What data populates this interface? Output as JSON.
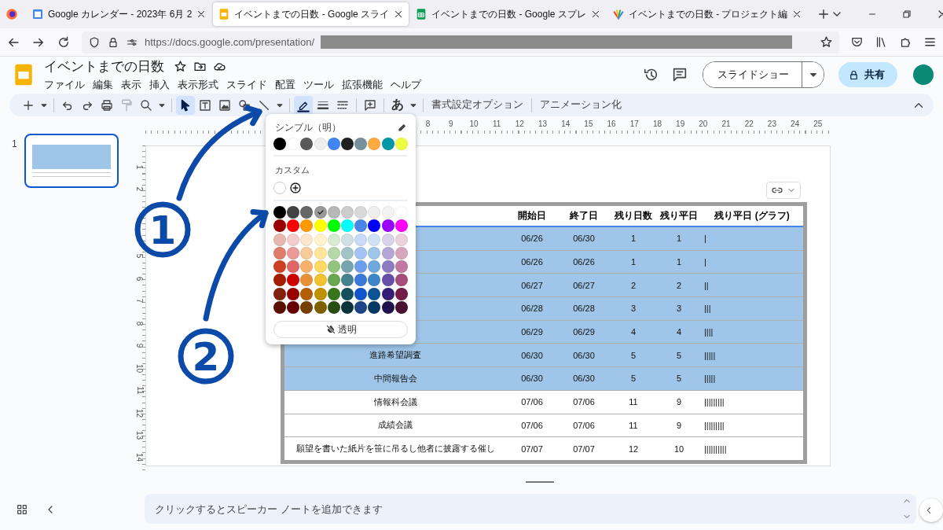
{
  "browser": {
    "tabs": [
      {
        "title": "Google カレンダー - 2023年 6月 2",
        "kind": "calendar",
        "selected": false
      },
      {
        "title": "イベントまでの日数 - Google スライ",
        "kind": "slides",
        "selected": true
      },
      {
        "title": "イベントまでの日数 - Google スプレ",
        "kind": "sheets",
        "selected": false
      },
      {
        "title": "イベントまでの日数 - プロジェクト編",
        "kind": "project",
        "selected": false
      }
    ],
    "url": "https://docs.google.com/presentation/"
  },
  "app": {
    "title": "イベントまでの日数",
    "menu": [
      "ファイル",
      "編集",
      "表示",
      "挿入",
      "表示形式",
      "スライド",
      "配置",
      "ツール",
      "拡張機能",
      "ヘルプ"
    ],
    "slideshow_label": "スライドショー",
    "share_label": "共有"
  },
  "toolbar": {
    "tools": [
      {
        "kind": "add",
        "active": false,
        "disabled": false
      },
      {
        "kind": "caret",
        "active": false,
        "disabled": false
      },
      {
        "kind": "divider"
      },
      {
        "kind": "undo",
        "active": false,
        "disabled": false
      },
      {
        "kind": "redo",
        "active": false,
        "disabled": false
      },
      {
        "kind": "print",
        "active": false,
        "disabled": false
      },
      {
        "kind": "paint-format",
        "active": false,
        "disabled": true
      },
      {
        "kind": "zoom",
        "active": false,
        "disabled": false
      },
      {
        "kind": "caret",
        "active": false,
        "disabled": false
      },
      {
        "kind": "divider"
      },
      {
        "kind": "select",
        "active": true,
        "disabled": false
      },
      {
        "kind": "textbox",
        "active": false,
        "disabled": false
      },
      {
        "kind": "image",
        "active": false,
        "disabled": false
      },
      {
        "kind": "shape",
        "active": false,
        "disabled": false
      },
      {
        "kind": "line",
        "active": false,
        "disabled": false
      },
      {
        "kind": "caret",
        "active": false,
        "disabled": false
      },
      {
        "kind": "divider"
      },
      {
        "kind": "pen",
        "active": true,
        "disabled": false
      },
      {
        "kind": "line-weight",
        "active": false,
        "disabled": false
      },
      {
        "kind": "line-dash",
        "active": false,
        "disabled": false
      },
      {
        "kind": "divider"
      },
      {
        "kind": "comment",
        "active": false,
        "disabled": false
      },
      {
        "kind": "divider"
      },
      {
        "kind": "glyph",
        "label": "あ",
        "active": false,
        "disabled": false
      },
      {
        "kind": "caret",
        "active": false,
        "disabled": false
      },
      {
        "kind": "divider"
      },
      {
        "kind": "text-button",
        "label": "書式設定オプション",
        "active": false,
        "disabled": false
      },
      {
        "kind": "divider"
      },
      {
        "kind": "text-button",
        "label": "アニメーション化",
        "active": false,
        "disabled": false
      }
    ]
  },
  "filmstrip": {
    "slides": [
      {
        "number": "1",
        "selected": true
      }
    ]
  },
  "ruler": {
    "horizontal": [
      "8",
      "9",
      "10",
      "11",
      "12",
      "13",
      "14",
      "15",
      "16",
      "17",
      "18",
      "19",
      "20",
      "21",
      "22",
      "23",
      "24",
      "25"
    ],
    "vertical_upper": [
      "1",
      "2"
    ],
    "vertical_lower": [
      "5",
      "6",
      "7",
      "8",
      "9",
      "10",
      "11",
      "12",
      "13",
      "14"
    ]
  },
  "table": {
    "columns": [
      "開始日",
      "終了日",
      "残り日数",
      "残り平日",
      "残り平日 (グラフ)"
    ],
    "rows": [
      {
        "selected": true,
        "cells": [
          "06/26",
          "06/30",
          "1",
          "1",
          "|"
        ]
      },
      {
        "selected": true,
        "cells": [
          "06/26",
          "06/26",
          "1",
          "1",
          "|"
        ]
      },
      {
        "selected": true,
        "cells": [
          "06/27",
          "06/27",
          "2",
          "2",
          "||"
        ]
      },
      {
        "selected": true,
        "cells": [
          "06/28",
          "06/28",
          "3",
          "3",
          "|||"
        ]
      },
      {
        "selected": true,
        "cells": [
          "06/29",
          "06/29",
          "4",
          "4",
          "||||"
        ]
      },
      {
        "selected": true,
        "name": "進路希望調査",
        "cells": [
          "06/30",
          "06/30",
          "5",
          "5",
          "|||||"
        ]
      },
      {
        "selected": true,
        "name": "中間報告会",
        "cells": [
          "06/30",
          "06/30",
          "5",
          "5",
          "|||||"
        ]
      },
      {
        "selected": false,
        "name": "情報科会議",
        "cells": [
          "07/06",
          "07/06",
          "11",
          "9",
          "|||||||||"
        ]
      },
      {
        "selected": false,
        "name": "成績会議",
        "cells": [
          "07/06",
          "07/06",
          "11",
          "9",
          "|||||||||"
        ]
      },
      {
        "selected": false,
        "name": "願望を書いた紙片を笹に吊るし他者に披露する催し",
        "cells": [
          "07/07",
          "07/07",
          "12",
          "10",
          "||||||||||"
        ]
      }
    ]
  },
  "color_menu": {
    "theme_name": "シンプル（明）",
    "theme_colors": [
      {
        "color": "#000000",
        "selected": false
      },
      {
        "color": "#ffffff",
        "selected": false
      },
      {
        "color": "#595959",
        "selected": false
      },
      {
        "color": "#eeeeee",
        "selected": false
      },
      {
        "color": "#4285f4",
        "selected": false
      },
      {
        "color": "#212121",
        "selected": false
      },
      {
        "color": "#78909c",
        "selected": false
      },
      {
        "color": "#ffab40",
        "selected": false
      },
      {
        "color": "#0097a7",
        "selected": false
      },
      {
        "color": "#eeff41",
        "selected": false
      }
    ],
    "custom_label": "カスタム",
    "palette": [
      [
        {
          "color": "#000000",
          "selected": false
        },
        {
          "color": "#434343",
          "selected": false
        },
        {
          "color": "#666666",
          "selected": false
        },
        {
          "color": "#999999",
          "selected": true
        },
        {
          "color": "#b7b7b7",
          "selected": false
        },
        {
          "color": "#cccccc",
          "selected": false
        },
        {
          "color": "#d9d9d9",
          "selected": false
        },
        {
          "color": "#efefef",
          "selected": false
        },
        {
          "color": "#f3f3f3",
          "selected": false
        },
        {
          "color": "#ffffff",
          "selected": false
        }
      ],
      [
        {
          "color": "#980000",
          "selected": false
        },
        {
          "color": "#ff0000",
          "selected": false
        },
        {
          "color": "#ff9900",
          "selected": false
        },
        {
          "color": "#ffff00",
          "selected": false
        },
        {
          "color": "#00ff00",
          "selected": false
        },
        {
          "color": "#00ffff",
          "selected": false
        },
        {
          "color": "#4a86e8",
          "selected": false
        },
        {
          "color": "#0000ff",
          "selected": false
        },
        {
          "color": "#9900ff",
          "selected": false
        },
        {
          "color": "#ff00ff",
          "selected": false
        }
      ],
      [
        {
          "color": "#e6b8af",
          "selected": false
        },
        {
          "color": "#f4cccc",
          "selected": false
        },
        {
          "color": "#fce5cd",
          "selected": false
        },
        {
          "color": "#fff2cc",
          "selected": false
        },
        {
          "color": "#d9ead3",
          "selected": false
        },
        {
          "color": "#d0e0e3",
          "selected": false
        },
        {
          "color": "#c9daf8",
          "selected": false
        },
        {
          "color": "#cfe2f3",
          "selected": false
        },
        {
          "color": "#d9d2e9",
          "selected": false
        },
        {
          "color": "#ead1dc",
          "selected": false
        }
      ],
      [
        {
          "color": "#dd7e6b",
          "selected": false
        },
        {
          "color": "#ea9999",
          "selected": false
        },
        {
          "color": "#f9cb9c",
          "selected": false
        },
        {
          "color": "#ffe599",
          "selected": false
        },
        {
          "color": "#b6d7a8",
          "selected": false
        },
        {
          "color": "#a2c4c9",
          "selected": false
        },
        {
          "color": "#a4c2f4",
          "selected": false
        },
        {
          "color": "#9fc5e8",
          "selected": false
        },
        {
          "color": "#b4a7d6",
          "selected": false
        },
        {
          "color": "#d5a6bd",
          "selected": false
        }
      ],
      [
        {
          "color": "#cc4125",
          "selected": false
        },
        {
          "color": "#e06666",
          "selected": false
        },
        {
          "color": "#f6b26b",
          "selected": false
        },
        {
          "color": "#ffd966",
          "selected": false
        },
        {
          "color": "#93c47d",
          "selected": false
        },
        {
          "color": "#76a5af",
          "selected": false
        },
        {
          "color": "#6d9eeb",
          "selected": false
        },
        {
          "color": "#6fa8dc",
          "selected": false
        },
        {
          "color": "#8e7cc3",
          "selected": false
        },
        {
          "color": "#c27ba0",
          "selected": false
        }
      ],
      [
        {
          "color": "#a61c00",
          "selected": false
        },
        {
          "color": "#cc0000",
          "selected": false
        },
        {
          "color": "#e69138",
          "selected": false
        },
        {
          "color": "#f1c232",
          "selected": false
        },
        {
          "color": "#6aa84f",
          "selected": false
        },
        {
          "color": "#45818e",
          "selected": false
        },
        {
          "color": "#3c78d8",
          "selected": false
        },
        {
          "color": "#3d85c6",
          "selected": false
        },
        {
          "color": "#674ea7",
          "selected": false
        },
        {
          "color": "#a64d79",
          "selected": false
        }
      ],
      [
        {
          "color": "#85200c",
          "selected": false
        },
        {
          "color": "#990000",
          "selected": false
        },
        {
          "color": "#b45f06",
          "selected": false
        },
        {
          "color": "#bf9000",
          "selected": false
        },
        {
          "color": "#38761d",
          "selected": false
        },
        {
          "color": "#134f5c",
          "selected": false
        },
        {
          "color": "#1155cc",
          "selected": false
        },
        {
          "color": "#0b5394",
          "selected": false
        },
        {
          "color": "#351c75",
          "selected": false
        },
        {
          "color": "#741b47",
          "selected": false
        }
      ],
      [
        {
          "color": "#5b0f00",
          "selected": false
        },
        {
          "color": "#660000",
          "selected": false
        },
        {
          "color": "#783f04",
          "selected": false
        },
        {
          "color": "#7f6000",
          "selected": false
        },
        {
          "color": "#274e13",
          "selected": false
        },
        {
          "color": "#0c343d",
          "selected": false
        },
        {
          "color": "#1c4587",
          "selected": false
        },
        {
          "color": "#073763",
          "selected": false
        },
        {
          "color": "#20124d",
          "selected": false
        },
        {
          "color": "#4c1130",
          "selected": false
        }
      ]
    ],
    "transparent_label": "透明"
  },
  "annotations": [
    {
      "number": "1"
    },
    {
      "number": "2"
    }
  ],
  "notes": {
    "placeholder": "クリックするとスピーカー ノートを追加できます"
  }
}
